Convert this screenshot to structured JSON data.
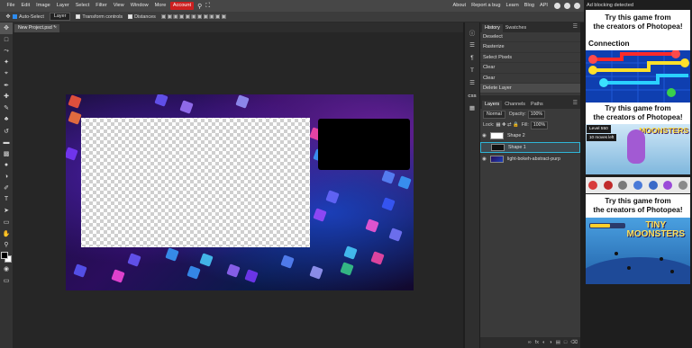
{
  "menu": {
    "items": [
      "File",
      "Edit",
      "Image",
      "Layer",
      "Select",
      "Filter",
      "View",
      "Window",
      "More"
    ],
    "account": "Account",
    "right_links": [
      "About",
      "Report a bug",
      "Learn",
      "Blog",
      "API"
    ]
  },
  "options": {
    "auto_select_label": "Auto-Select",
    "layer_select": "Layer",
    "transform_controls_label": "Transform controls",
    "distances_label": "Distances"
  },
  "document_tab": {
    "title": "New Project.psd *",
    "close": "×"
  },
  "history_panel": {
    "tabs": [
      "History",
      "Swatches"
    ],
    "items": [
      "Deselect",
      "Rasterize",
      "Select Pixels",
      "Clear",
      "Clear",
      "Delete Layer"
    ]
  },
  "layers_panel": {
    "tabs": [
      "Layers",
      "Channels",
      "Paths"
    ],
    "blend_mode": "Normal",
    "opacity_label": "Opacity:",
    "opacity_value": "100%",
    "lock_label": "Lock:",
    "fill_label": "Fill:",
    "fill_value": "100%",
    "layers": [
      {
        "name": "Shape 2",
        "selected": false
      },
      {
        "name": "Shape 1",
        "selected": true
      },
      {
        "name": "light-bokeh-abstract-purp",
        "selected": false
      }
    ]
  },
  "side_icons": {
    "css_label": "CSS"
  },
  "ads": {
    "header": "Ad blocking detected",
    "promo_line1": "Try this game from",
    "promo_line2": "the creators of Photopea!",
    "connection_title": "Connection",
    "monsters_title": "MOONSTERS",
    "level_text": "Level 550",
    "moves_text": "10 moves left",
    "tiny_title_line1": "TINY",
    "tiny_title_line2": "MOONSTERS"
  },
  "colors": {
    "accent_red": "#cc1f1f",
    "selection_cyan": "#2fb6d8",
    "panel_bg": "#3a3a3a",
    "menubar_bg": "#474747"
  }
}
